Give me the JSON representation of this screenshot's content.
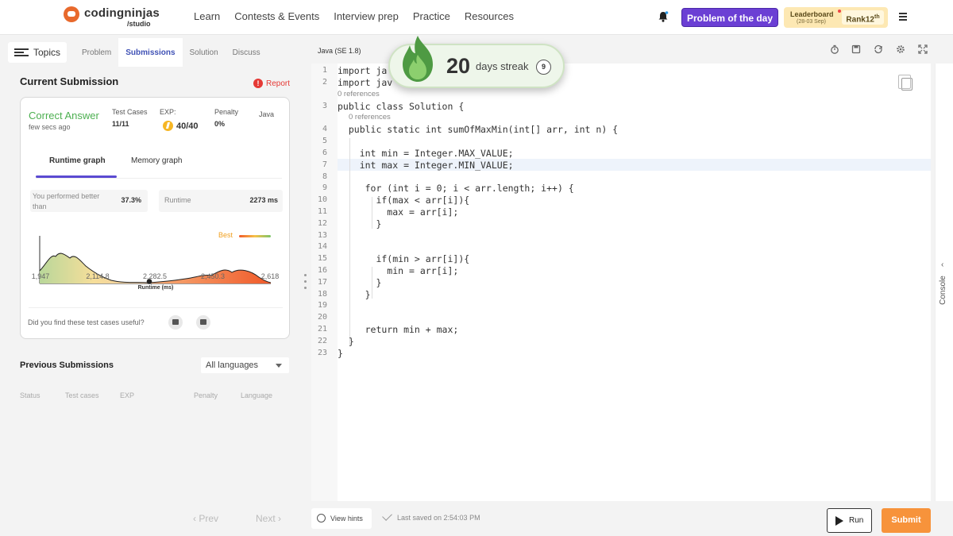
{
  "brand": {
    "name": "codingninjas",
    "sub": "/studio"
  },
  "nav": [
    "Learn",
    "Contests & Events",
    "Interview prep",
    "Practice",
    "Resources"
  ],
  "header": {
    "potd_label": "Problem of the day",
    "leaderboard_label": "Leaderboard",
    "leaderboard_dates": "(28-03 Sep)",
    "rank_label": "Rank",
    "rank_value": "12",
    "rank_suffix": "th"
  },
  "left_tabs": {
    "topics": "Topics",
    "tabs": [
      "Problem",
      "Submissions",
      "Solution",
      "Discuss"
    ],
    "active": "Submissions"
  },
  "current_submission": {
    "title": "Current Submission",
    "report": "Report",
    "status": "Correct Answer",
    "time_ago": "few secs ago",
    "test_cases_label": "Test Cases",
    "test_cases_value": "11/11",
    "exp_label": "EXP:",
    "exp_value": "40/40",
    "penalty_label": "Penalty",
    "penalty_value": "0%",
    "language": "Java",
    "graph_tabs": [
      "Runtime graph",
      "Memory graph"
    ],
    "performed_label": "You performed better than",
    "performed_value": "37.3%",
    "runtime_label": "Runtime",
    "runtime_value": "2273 ms",
    "best_label": "Best",
    "x_ticks": [
      "1,947",
      "2,114.8",
      "2,282.5",
      "2,450.3",
      "2,618"
    ],
    "x_label": "Runtime (ms)",
    "useful_question": "Did you find these test cases useful?"
  },
  "colors": {
    "accent": "#6b3fd4",
    "success": "#4caf50",
    "submit": "#f7933b",
    "report": "#e53935"
  },
  "previous": {
    "title": "Previous Submissions",
    "language_filter": "All languages",
    "columns": [
      "Status",
      "Test cases",
      "EXP",
      "Penalty",
      "Language"
    ],
    "prev_label": "Prev",
    "next_label": "Next"
  },
  "editor": {
    "language": "Java (SE 1.8)",
    "references_label": "0 references",
    "lines": [
      "import ja",
      "import jav",
      "public class Solution {",
      "  public static int sumOfMaxMin(int[] arr, int n) {",
      "",
      "    int min = Integer.MAX_VALUE;",
      "    int max = Integer.MIN_VALUE;",
      "",
      "     for (int i = 0; i < arr.length; i++) {",
      "       if(max < arr[i]){",
      "         max = arr[i];",
      "       }",
      "",
      "",
      "       if(min > arr[i]){",
      "         min = arr[i];",
      "       }",
      "     }",
      "",
      "",
      "     return min + max;",
      "  }",
      "}"
    ],
    "console_label": "Console"
  },
  "footer": {
    "hints_label": "View hints",
    "saved_label": "Last saved on 2:54:03 PM",
    "run_label": "Run",
    "submit_label": "Submit"
  },
  "streak": {
    "value": "20",
    "label": "days streak",
    "badge": "9"
  }
}
